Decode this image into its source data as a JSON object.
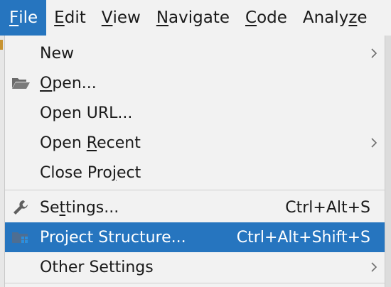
{
  "menubar": {
    "items": [
      {
        "label": "File",
        "mnemonic": "F",
        "rest": "ile"
      },
      {
        "label": "Edit",
        "mnemonic": "E",
        "rest": "dit"
      },
      {
        "label": "View",
        "mnemonic": "V",
        "rest": "iew"
      },
      {
        "label": "Navigate",
        "mnemonic": "N",
        "rest": "avigate"
      },
      {
        "label": "Code",
        "mnemonic": "C",
        "rest": "ode"
      },
      {
        "label": "Analyze",
        "pre": "Analy",
        "mnemonic": "z",
        "rest": "e"
      }
    ]
  },
  "file_menu": {
    "new": {
      "label": "New",
      "icon": "none",
      "submenu": true
    },
    "open": {
      "pre": "",
      "mnemonic": "O",
      "rest": "pen...",
      "label": "Open...",
      "icon": "folder-open-icon"
    },
    "open_url": {
      "label": "Open URL..."
    },
    "open_recent": {
      "pre": "Open ",
      "mnemonic": "R",
      "rest": "ecent",
      "label": "Open Recent",
      "submenu": true
    },
    "close_project": {
      "pre": "Close Pro",
      "mnemonic": "j",
      "rest": "ect",
      "label": "Close Project"
    },
    "settings": {
      "pre": "Se",
      "mnemonic": "t",
      "rest": "tings...",
      "label": "Settings...",
      "shortcut": "Ctrl+Alt+S",
      "icon": "wrench-icon"
    },
    "project_structure": {
      "label": "Project Structure...",
      "shortcut": "Ctrl+Alt+Shift+S",
      "icon": "project-structure-icon",
      "selected": true
    },
    "other_settings": {
      "label": "Other Settings",
      "submenu": true
    }
  },
  "colors": {
    "accent": "#2675bf",
    "menu_bg": "#f2f2f2",
    "separator": "#cfcfcf"
  }
}
